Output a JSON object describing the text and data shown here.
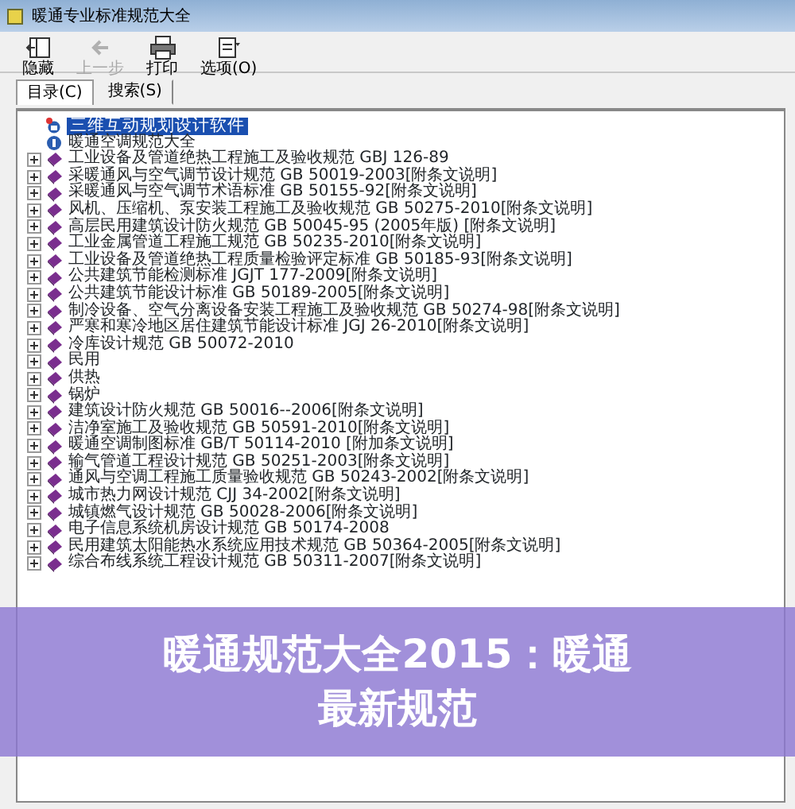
{
  "window": {
    "title": "暖通专业标准规范大全"
  },
  "toolbar": [
    {
      "label": "隐藏",
      "kind": "hide",
      "disabled": false
    },
    {
      "label": "上一步",
      "kind": "back",
      "disabled": true
    },
    {
      "label": "打印",
      "kind": "print",
      "disabled": false
    },
    {
      "label": "选项(O)",
      "kind": "options",
      "disabled": false
    }
  ],
  "tabs": [
    {
      "label": "目录(C)",
      "selected": true
    },
    {
      "label": "搜索(S)",
      "selected": false
    }
  ],
  "tree": {
    "items": [
      {
        "label": "三维互动规划设计软件",
        "kind": "link",
        "selected": true
      },
      {
        "label": "暖通空调规范大全",
        "kind": "help",
        "selected": false
      },
      {
        "label": "工业设备及管道绝热工程施工及验收规范 GBJ 126-89",
        "kind": "book",
        "selected": false
      },
      {
        "label": "采暖通风与空气调节设计规范 GB 50019-2003[附条文说明]",
        "kind": "book",
        "selected": false
      },
      {
        "label": "采暖通风与空气调节术语标准 GB 50155-92[附条文说明]",
        "kind": "book",
        "selected": false
      },
      {
        "label": "风机、压缩机、泵安装工程施工及验收规范 GB 50275-2010[附条文说明]",
        "kind": "book",
        "selected": false
      },
      {
        "label": "高层民用建筑设计防火规范 GB 50045-95 (2005年版) [附条文说明]",
        "kind": "book",
        "selected": false
      },
      {
        "label": "工业金属管道工程施工规范 GB 50235-2010[附条文说明]",
        "kind": "book",
        "selected": false
      },
      {
        "label": "工业设备及管道绝热工程质量检验评定标准 GB 50185-93[附条文说明]",
        "kind": "book",
        "selected": false
      },
      {
        "label": "公共建筑节能检测标准 JGJT 177-2009[附条文说明]",
        "kind": "book",
        "selected": false
      },
      {
        "label": "公共建筑节能设计标准 GB 50189-2005[附条文说明]",
        "kind": "book",
        "selected": false
      },
      {
        "label": "制冷设备、空气分离设备安装工程施工及验收规范 GB 50274-98[附条文说明]",
        "kind": "book",
        "selected": false
      },
      {
        "label": "严寒和寒冷地区居住建筑节能设计标准 JGJ 26-2010[附条文说明]",
        "kind": "book",
        "selected": false
      },
      {
        "label": "冷库设计规范 GB 50072-2010",
        "kind": "book",
        "selected": false
      },
      {
        "label": "民用",
        "kind": "book",
        "selected": false
      },
      {
        "label": "供热",
        "kind": "book",
        "selected": false
      },
      {
        "label": "锅炉",
        "kind": "book",
        "selected": false
      },
      {
        "label": "建筑设计防火规范 GB 50016--2006[附条文说明]",
        "kind": "book",
        "selected": false
      },
      {
        "label": "洁净室施工及验收规范 GB 50591-2010[附条文说明]",
        "kind": "book",
        "selected": false
      },
      {
        "label": "暖通空调制图标准 GB/T 50114-2010 [附加条文说明]",
        "kind": "book",
        "selected": false
      },
      {
        "label": "输气管道工程设计规范 GB 50251-2003[附条文说明]",
        "kind": "book",
        "selected": false
      },
      {
        "label": "通风与空调工程施工质量验收规范 GB 50243-2002[附条文说明]",
        "kind": "book",
        "selected": false
      },
      {
        "label": "城市热力网设计规范 CJJ 34-2002[附条文说明]",
        "kind": "book",
        "selected": false
      },
      {
        "label": "城镇燃气设计规范 GB 50028-2006[附条文说明]",
        "kind": "book",
        "selected": false
      },
      {
        "label": "电子信息系统机房设计规范 GB 50174-2008",
        "kind": "book",
        "selected": false
      },
      {
        "label": "民用建筑太阳能热水系统应用技术规范 GB 50364-2005[附条文说明]",
        "kind": "book",
        "selected": false
      },
      {
        "label": "综合布线系统工程设计规范 GB 50311-2007[附条文说明]",
        "kind": "book",
        "selected": false
      }
    ]
  },
  "banner": {
    "text": "暖通规范大全2015：暖通最新规范"
  }
}
